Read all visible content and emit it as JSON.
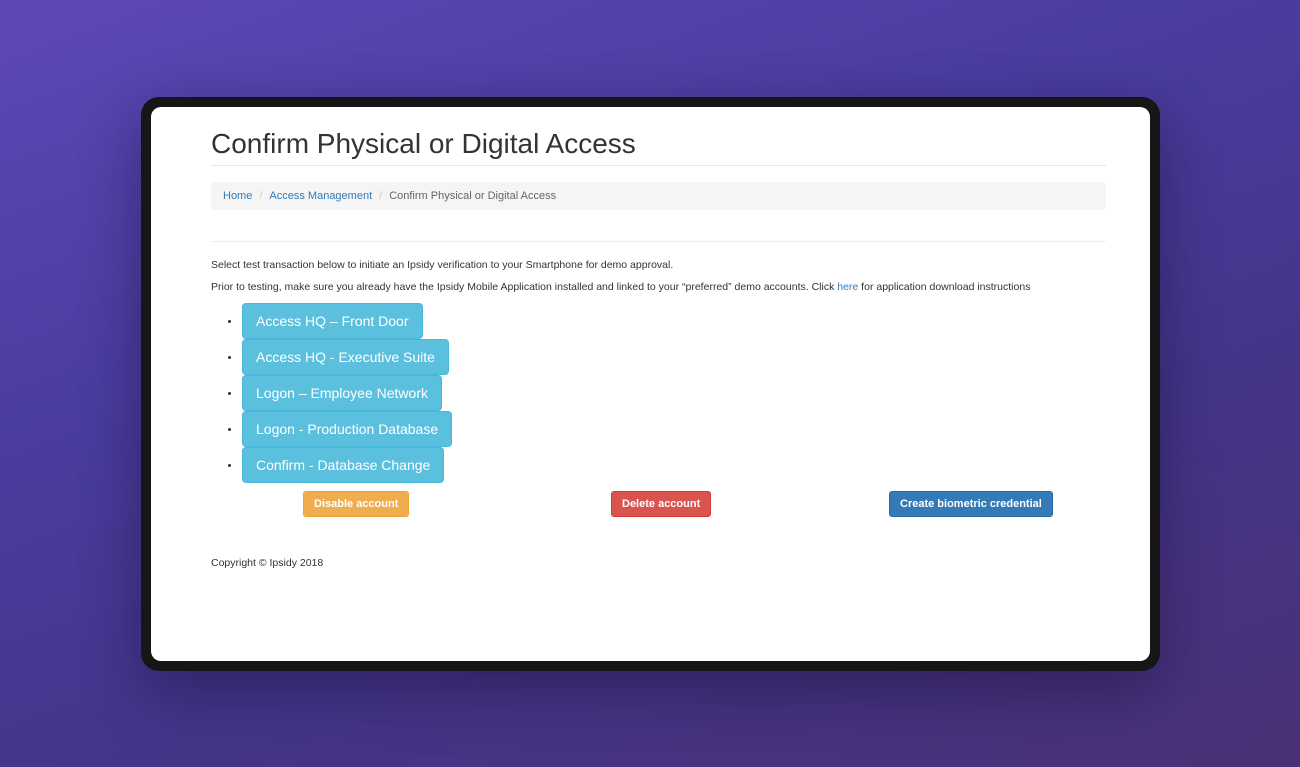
{
  "page": {
    "title": "Confirm Physical or Digital Access"
  },
  "breadcrumb": {
    "items": [
      "Home",
      "Access Management",
      "Confirm Physical or Digital Access"
    ],
    "separator": "/"
  },
  "intro": {
    "line1": "Select test transaction below to initiate an Ipsidy verification to your Smartphone for demo approval.",
    "line2_before": "Prior to testing, make sure you already have the Ipsidy Mobile Application installed and linked to your “preferred” demo accounts.  Click ",
    "line2_link": "here",
    "line2_after": " for application download instructions"
  },
  "transactions": [
    "Access HQ – Front Door",
    "Access HQ - Executive Suite",
    "Logon – Employee Network",
    "Logon - Production Database",
    "Confirm - Database Change"
  ],
  "actions": {
    "disable": "Disable account",
    "delete": "Delete account",
    "create": "Create biometric credential"
  },
  "footer": {
    "copyright": "Copyright © Ipsidy 2018"
  },
  "colors": {
    "info": "#5bc0de",
    "warning": "#f0ad4e",
    "danger": "#d9534f",
    "primary": "#337ab7",
    "link": "#337ab7"
  }
}
